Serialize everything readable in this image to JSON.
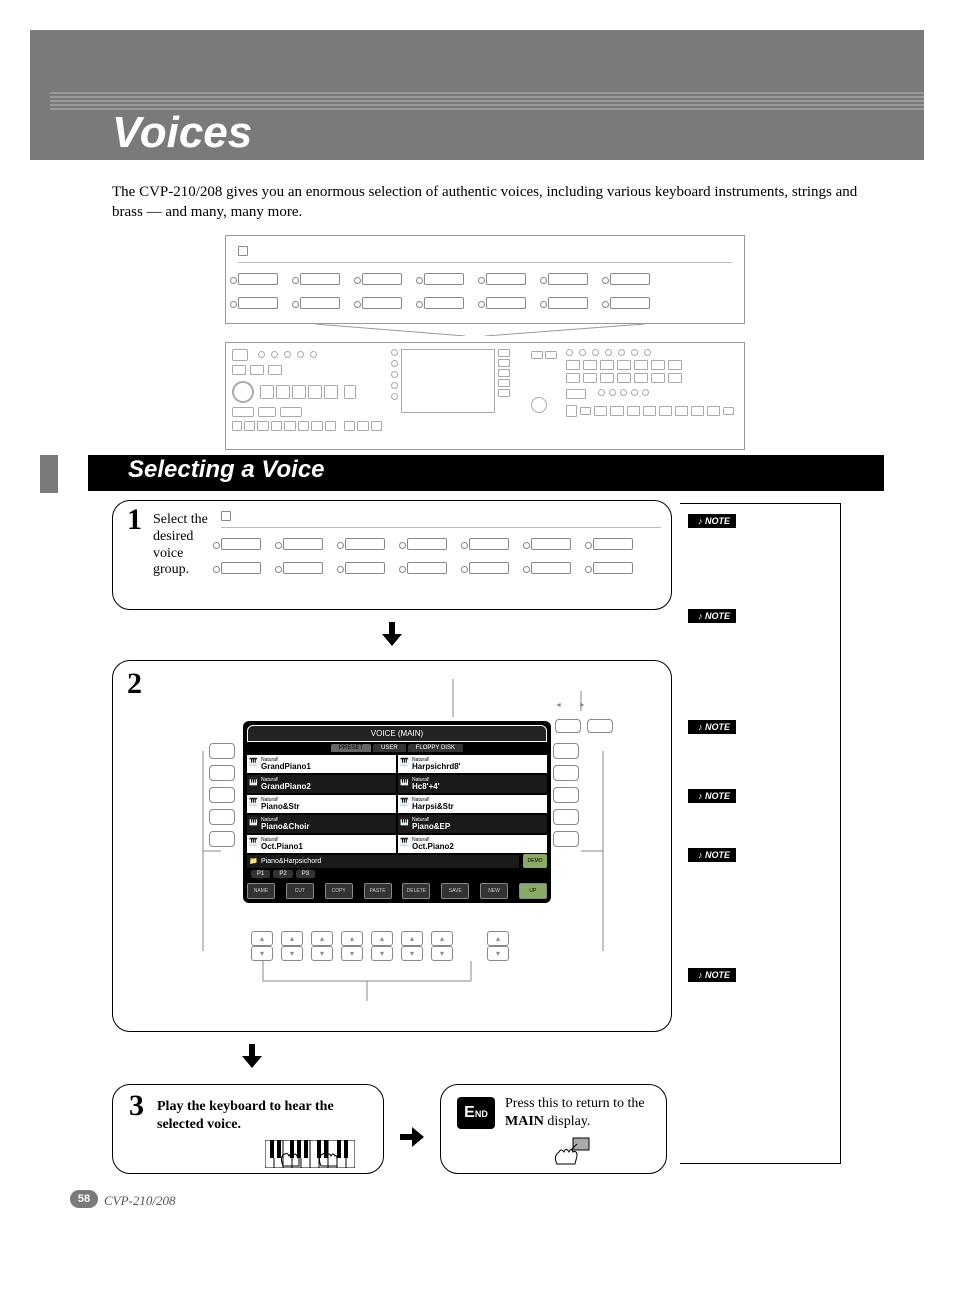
{
  "page": {
    "number": "58",
    "model": "CVP-210/208"
  },
  "chapter": {
    "title": "Voices",
    "intro": "The CVP-210/208 gives you an enormous selection of authentic voices, including various keyboard instruments, strings and brass — and many, many more."
  },
  "section": {
    "title": "Selecting a Voice"
  },
  "steps": {
    "step1": {
      "num": "1",
      "text": "Select the desired voice group."
    },
    "step2": {
      "num": "2",
      "lcd": {
        "header": "VOICE (MAIN)",
        "tabs": [
          "PRESET",
          "USER",
          "FLOPPY DISK"
        ],
        "items_left": [
          {
            "nat": "Natural!",
            "name": "GrandPiano1"
          },
          {
            "nat": "Natural!",
            "name": "GrandPiano2"
          },
          {
            "nat": "Natural!",
            "name": "Piano&Str"
          },
          {
            "nat": "Natural!",
            "name": "Piano&Choir"
          },
          {
            "nat": "Natural!",
            "name": "Oct.Piano1"
          }
        ],
        "items_right": [
          {
            "nat": "Natural!",
            "name": "Harpsichrd8'"
          },
          {
            "nat": "Natural!",
            "name": "Hc8'+4'"
          },
          {
            "nat": "Natural!",
            "name": "Harpsi&Str"
          },
          {
            "nat": "Natural!",
            "name": "Piano&EP"
          },
          {
            "nat": "Natural!",
            "name": "Oct.Piano2"
          }
        ],
        "folder": "Piano&Harpsichord",
        "pages": [
          "P1",
          "P2",
          "P3"
        ],
        "demo_label": "DEMO",
        "bottom_icons": [
          "NAME",
          "CUT",
          "COPY",
          "PASTE",
          "DELETE",
          "SAVE",
          "NEW"
        ],
        "up_label": "UP"
      },
      "tab_arrows": [
        "◄",
        "►"
      ]
    },
    "step3": {
      "num": "3",
      "text_pre": "Play the keyboard to hear the selected voice.",
      "text_bold_words": [
        "Play the keyboard to hear the selected voice."
      ]
    },
    "end": {
      "badge": "END",
      "text_pre": "Press this to return to the ",
      "text_bold": "MAIN",
      "text_post": " display."
    }
  },
  "notes": {
    "label": "NOTE",
    "items": [
      "",
      "",
      "",
      "",
      "",
      ""
    ]
  }
}
